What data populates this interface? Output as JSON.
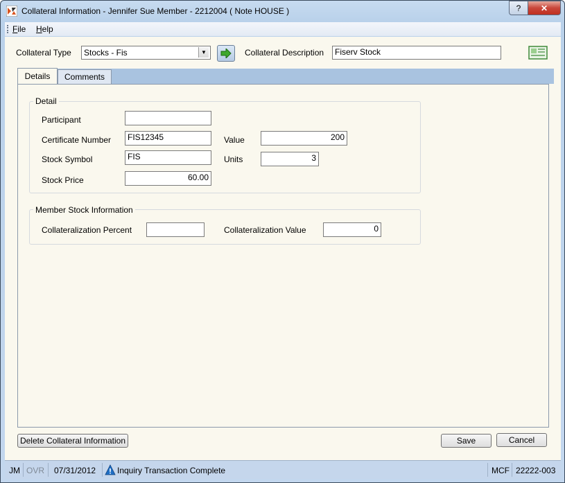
{
  "window": {
    "title": "Collateral Information - Jennifer Sue Member - 2212004 ( Note  HOUSE )",
    "help_glyph": "?",
    "close_glyph": "✕"
  },
  "menu": {
    "file_accel": "F",
    "file_rest": "ile",
    "help_accel": "H",
    "help_rest": "elp"
  },
  "header": {
    "collateral_type_label": "Collateral Type",
    "collateral_type_value": "Stocks - Fis",
    "collateral_description_label": "Collateral Description",
    "collateral_description_value": "Fiserv Stock"
  },
  "tabs": [
    {
      "label": "Details",
      "active": true
    },
    {
      "label": "Comments",
      "active": false
    }
  ],
  "detail": {
    "group_title": "Detail",
    "participant_label": "Participant",
    "participant_value": "",
    "certificate_number_label": "Certificate Number",
    "certificate_number_value": "FIS12345",
    "value_label": "Value",
    "value_value": "200",
    "stock_symbol_label": "Stock Symbol",
    "stock_symbol_value": "FIS",
    "units_label": "Units",
    "units_value": "3",
    "stock_price_label": "Stock Price",
    "stock_price_value": "60.00"
  },
  "member_stock": {
    "group_title": "Member Stock Information",
    "collateralization_percent_label": "Collateralization Percent",
    "collateralization_percent_value": "",
    "collateralization_value_label": "Collateralization Value",
    "collateralization_value_value": "0"
  },
  "buttons": {
    "delete": "Delete Collateral Information",
    "save": "Save",
    "cancel": "Cancel"
  },
  "status": {
    "user": "JM",
    "ovr": "OVR",
    "date": "07/31/2012",
    "message": "Inquiry Transaction Complete",
    "mode": "MCF",
    "code": "22222-003"
  },
  "colors": {
    "accent": "#1f6fc5",
    "go_arrow": "#3fa82d",
    "dialog_bg": "#faf8ee"
  }
}
